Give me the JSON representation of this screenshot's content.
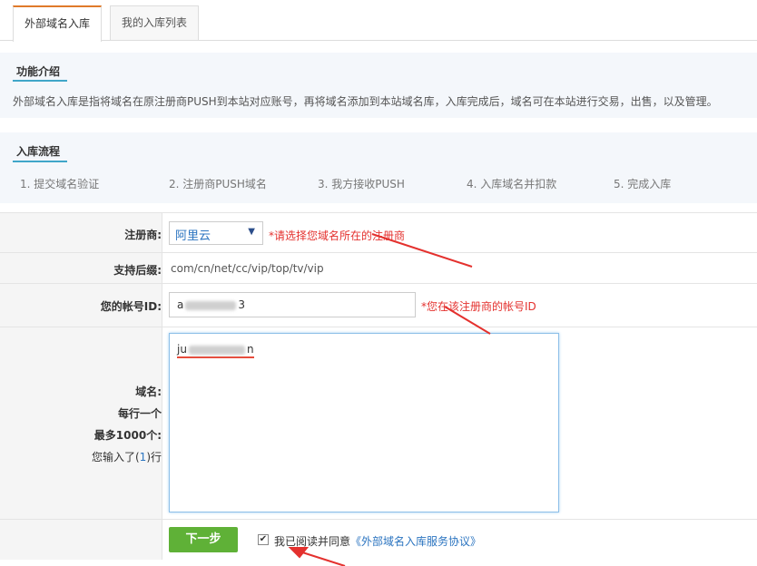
{
  "tabs": [
    {
      "label": "外部域名入库",
      "active": true
    },
    {
      "label": "我的入库列表",
      "active": false
    }
  ],
  "intro": {
    "title": "功能介绍",
    "text": "外部域名入库是指将域名在原注册商PUSH到本站对应账号，再将域名添加到本站域名库，入库完成后，域名可在本站进行交易，出售，以及管理。"
  },
  "flow": {
    "title": "入库流程",
    "steps": [
      "1. 提交域名验证",
      "2. 注册商PUSH域名",
      "3. 我方接收PUSH",
      "4. 入库域名并扣款",
      "5. 完成入库"
    ]
  },
  "form": {
    "registrar_label": "注册商:",
    "registrar_value": "阿里云",
    "registrar_hint": "*请选择您域名所在的注册商",
    "suffix_label": "支持后缀:",
    "suffix_value": "com/cn/net/cc/vip/top/tv/vip",
    "account_label": "您的帐号ID:",
    "account_prefix": "a",
    "account_suffix": "3",
    "account_hint": "*您在该注册商的帐号ID",
    "domain_label": "域名:",
    "domain_line2": "每行一个",
    "domain_line3": "最多1000个:",
    "count_prefix": "您输入了(",
    "count_value": "1",
    "count_suffix": ")行",
    "domain_prefix": "ju",
    "domain_suffix": "n"
  },
  "footer": {
    "next_label": "下一步",
    "agree_text": "我已阅读并同意",
    "agree_link": "《外部域名入库服务协议》",
    "checked": true
  },
  "colors": {
    "accent_red": "#e4312e",
    "button_green": "#5fb137",
    "link_blue": "#2b74c0",
    "tab_orange": "#e07a2a"
  }
}
